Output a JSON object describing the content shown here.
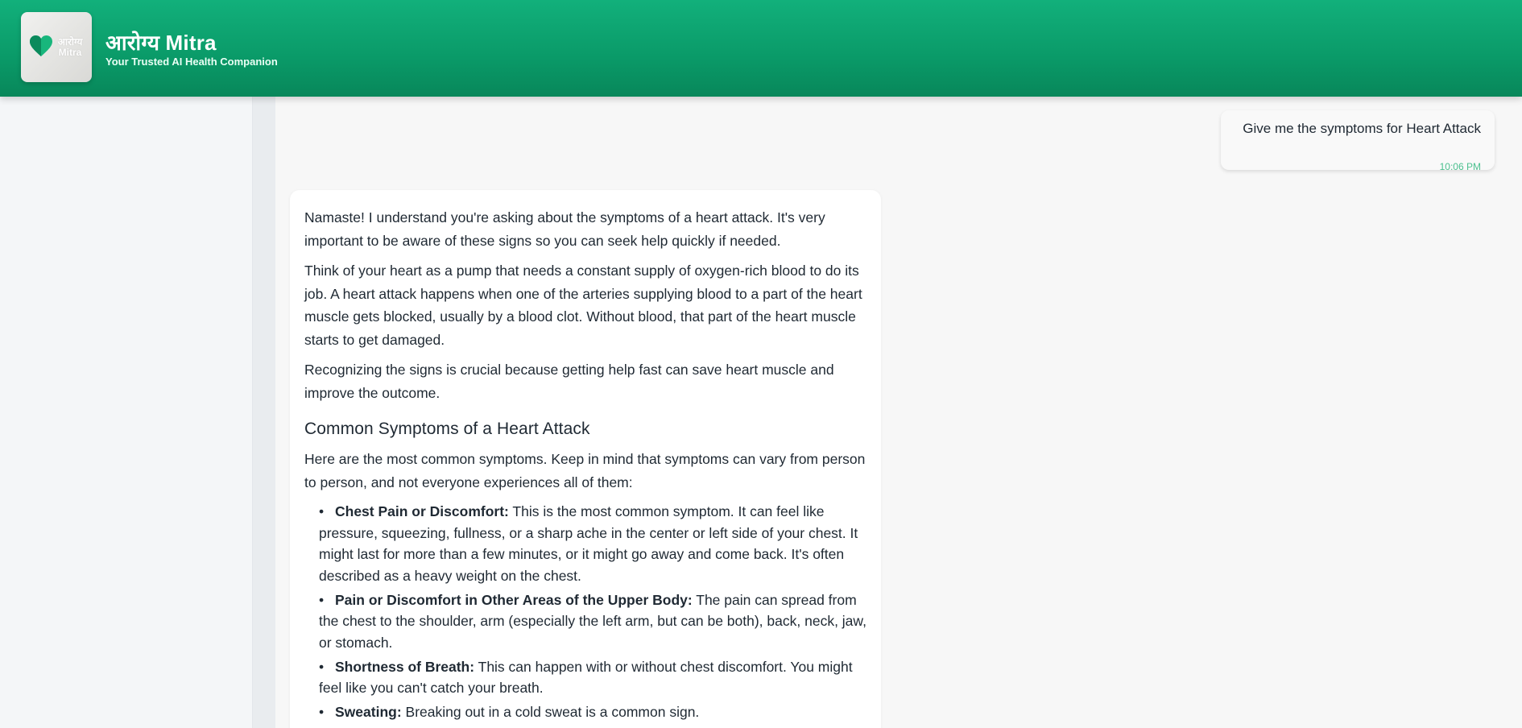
{
  "header": {
    "logo_text": "आरोग्य Mitra",
    "title": "आरोग्य Mitra",
    "subtitle": "Your Trusted AI Health Companion"
  },
  "chat": {
    "user_message": {
      "text": "Give me the symptoms for Heart Attack",
      "time": "10:06 PM"
    },
    "bot_message": {
      "paragraphs": [
        "Namaste! I understand you're asking about the symptoms of a heart attack. It's very important to be aware of these signs so you can seek help quickly if needed.",
        "Think of your heart as a pump that needs a constant supply of oxygen-rich blood to do its job. A heart attack happens when one of the arteries supplying blood to a part of the heart muscle gets blocked, usually by a blood clot. Without blood, that part of the heart muscle starts to get damaged.",
        "Recognizing the signs is crucial because getting help fast can save heart muscle and improve the outcome."
      ],
      "heading": "Common Symptoms of a Heart Attack",
      "intro": "Here are the most common symptoms. Keep in mind that symptoms can vary from person to person, and not everyone experiences all of them:",
      "symptoms": [
        {
          "title": "Chest Pain or Discomfort:",
          "text": " This is the most common symptom. It can feel like pressure, squeezing, fullness, or a sharp ache in the center or left side of your chest. It might last for more than a few minutes, or it might go away and come back. It's often described as a heavy weight on the chest."
        },
        {
          "title": "Pain or Discomfort in Other Areas of the Upper Body:",
          "text": " The pain can spread from the chest to the shoulder, arm (especially the left arm, but can be both), back, neck, jaw, or stomach."
        },
        {
          "title": "Shortness of Breath:",
          "text": " This can happen with or without chest discomfort. You might feel like you can't catch your breath."
        },
        {
          "title": "Sweating:",
          "text": " Breaking out in a cold sweat is a common sign."
        }
      ]
    }
  },
  "colors": {
    "header_green": "#0a9a68",
    "timestamp_green": "#4cc08f"
  }
}
